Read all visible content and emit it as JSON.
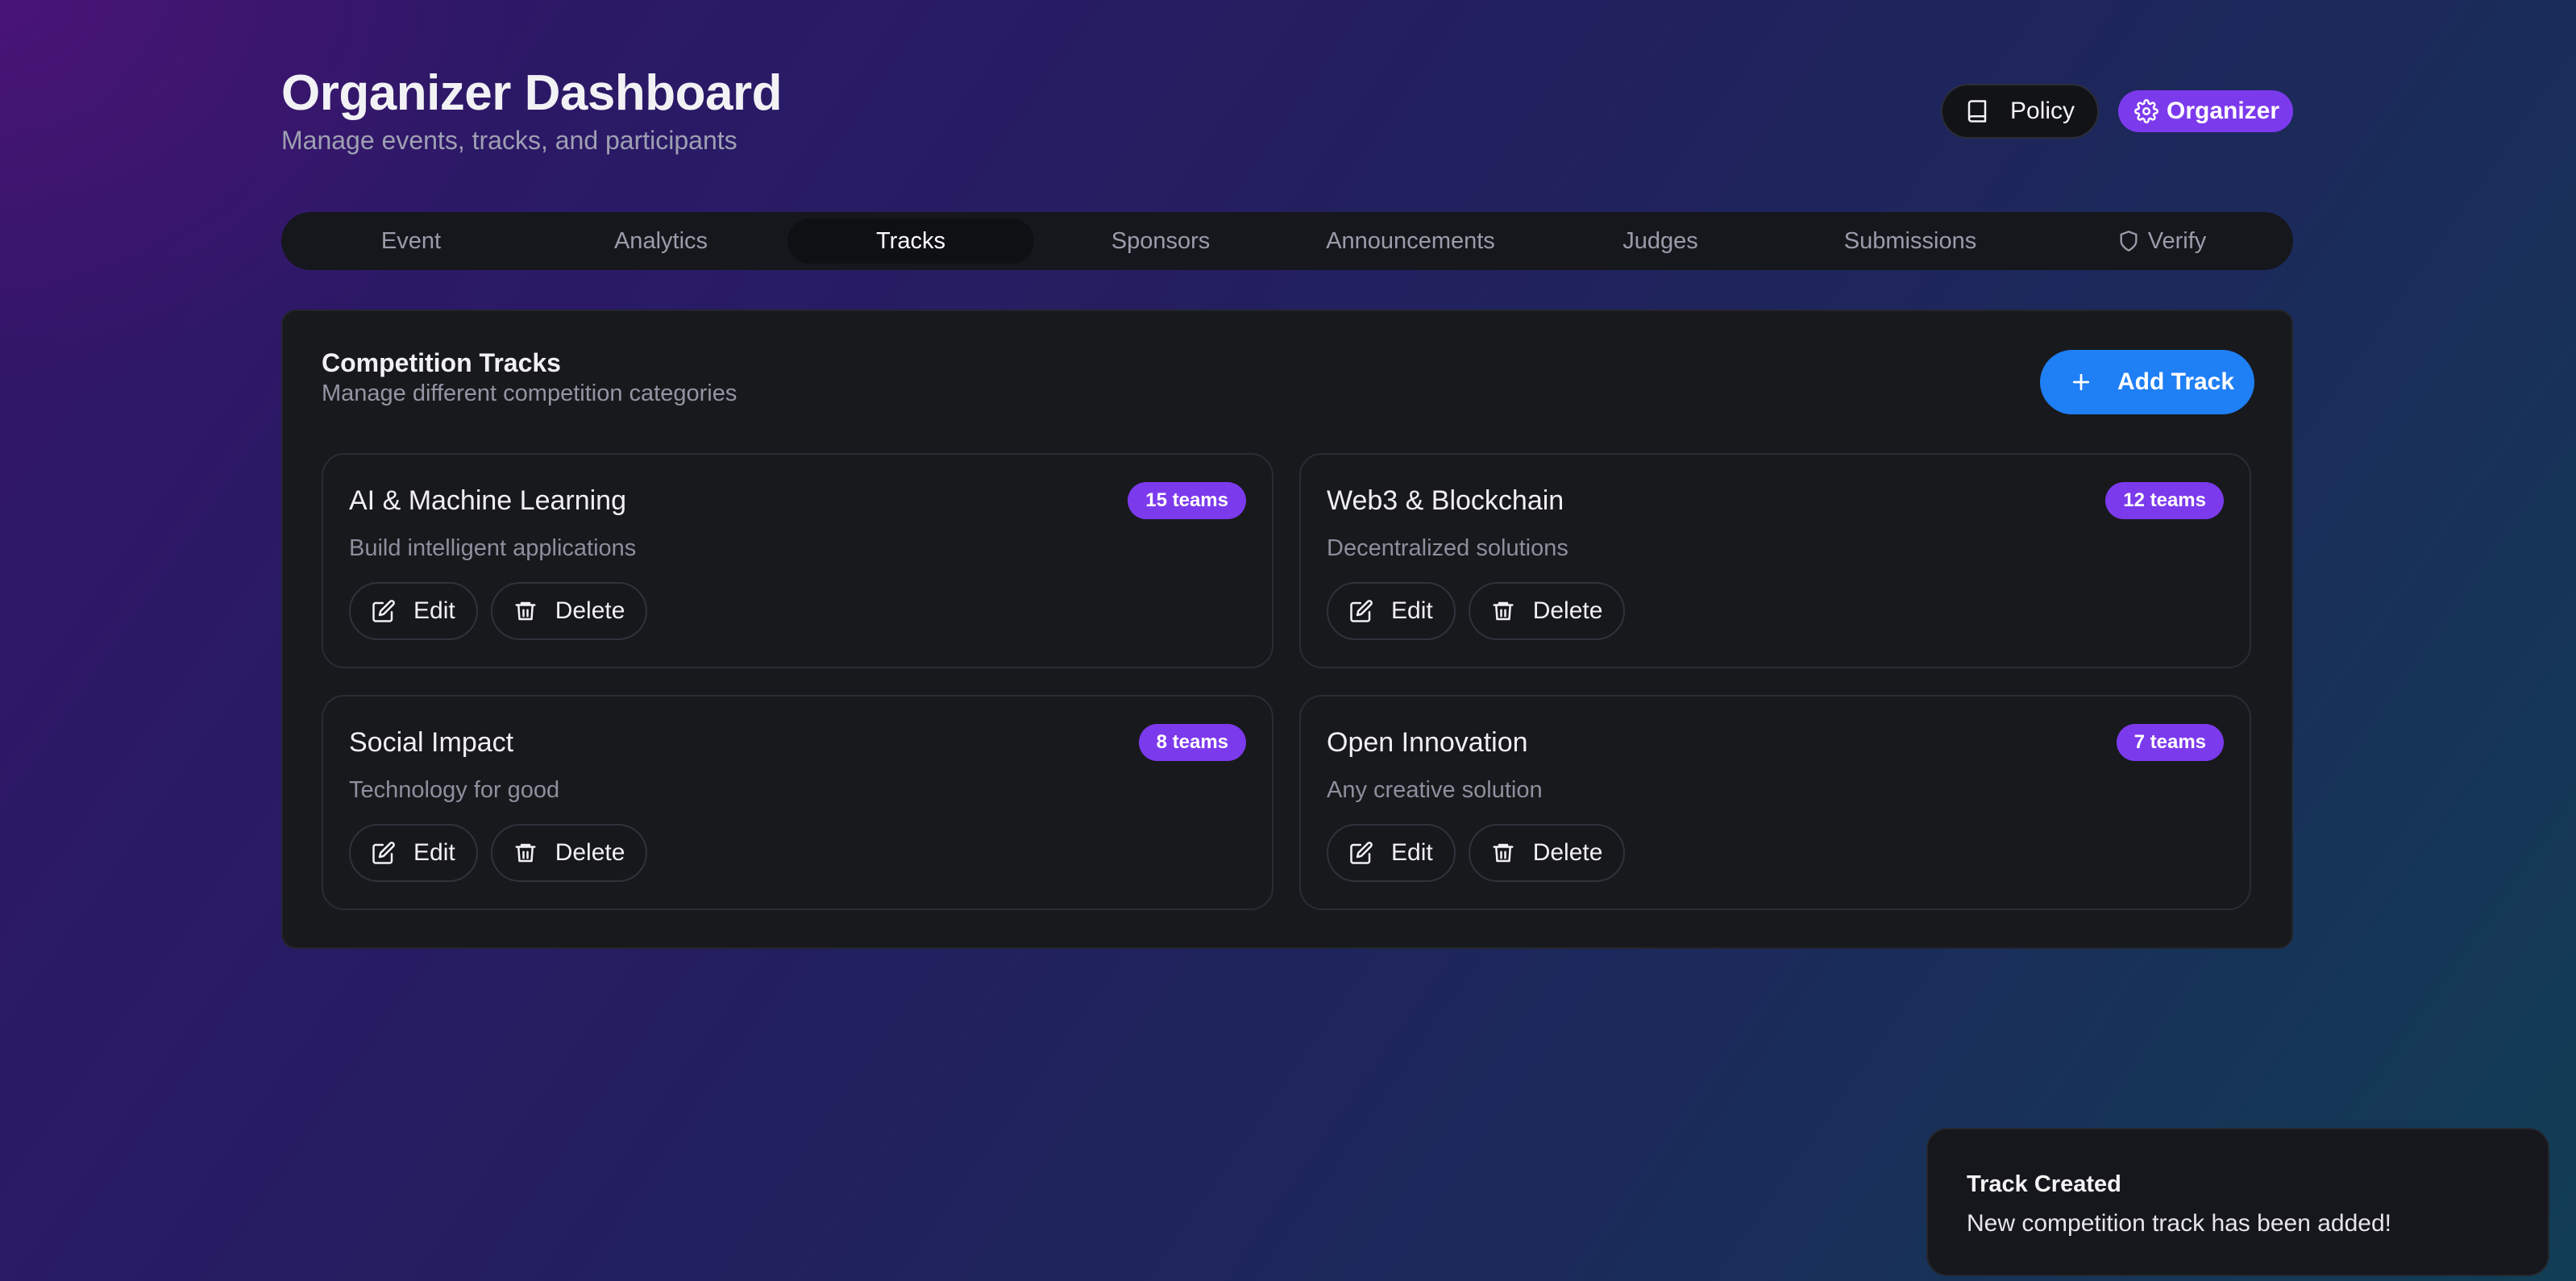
{
  "header": {
    "title": "Organizer Dashboard",
    "subtitle": "Manage events, tracks, and participants",
    "policy_label": "Policy",
    "role_label": "Organizer"
  },
  "tabs": [
    {
      "label": "Event",
      "active": false
    },
    {
      "label": "Analytics",
      "active": false
    },
    {
      "label": "Tracks",
      "active": true
    },
    {
      "label": "Sponsors",
      "active": false
    },
    {
      "label": "Announcements",
      "active": false
    },
    {
      "label": "Judges",
      "active": false
    },
    {
      "label": "Submissions",
      "active": false
    },
    {
      "label": "Verify",
      "active": false,
      "icon": "shield-icon"
    }
  ],
  "tracks_section": {
    "title": "Competition Tracks",
    "subtitle": "Manage different competition categories",
    "add_label": "Add Track",
    "edit_label": "Edit",
    "delete_label": "Delete",
    "tracks": [
      {
        "name": "AI & Machine Learning",
        "description": "Build intelligent applications",
        "teams": "15 teams"
      },
      {
        "name": "Web3 & Blockchain",
        "description": "Decentralized solutions",
        "teams": "12 teams"
      },
      {
        "name": "Social Impact",
        "description": "Technology for good",
        "teams": "8 teams"
      },
      {
        "name": "Open Innovation",
        "description": "Any creative solution",
        "teams": "7 teams"
      }
    ]
  },
  "toast": {
    "title": "Track Created",
    "message": "New competition track has been added!"
  },
  "colors": {
    "accent_purple": "#7c3aed",
    "accent_blue": "#1f7ff5",
    "card_bg": "#18191d"
  }
}
